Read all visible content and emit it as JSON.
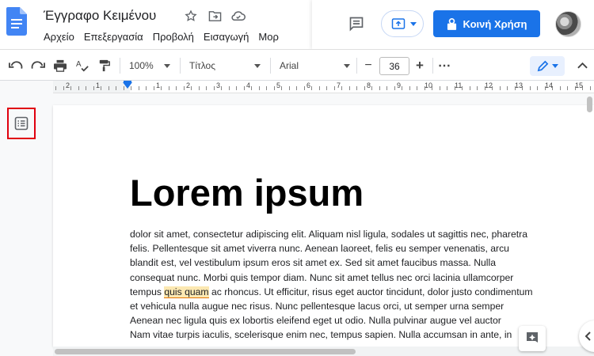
{
  "document": {
    "title": "Έγγραφο Κειμένου"
  },
  "menu": {
    "items": [
      "Αρχείο",
      "Επεξεργασία",
      "Προβολή",
      "Εισαγωγή",
      "Μορ"
    ]
  },
  "header": {
    "share_label": "Κοινή Χρήση",
    "accent_color": "#1a73e8"
  },
  "toolbar": {
    "zoom": "100%",
    "style": "Τίτλος",
    "font": "Arial",
    "font_size": "36",
    "decrease": "−",
    "increase": "+",
    "more": "⋯"
  },
  "ruler": {
    "numbers": [
      "2",
      "1",
      "1",
      "2",
      "3",
      "4",
      "5",
      "6",
      "7",
      "8",
      "9",
      "10",
      "11",
      "12",
      "13",
      "14",
      "15"
    ]
  },
  "content": {
    "heading": "Lorem ipsum",
    "lines": [
      "dolor sit amet, consectetur adipiscing elit. Aliquam nisl ligula, sodales ut sagittis  nec, pharetra",
      "felis. Pellentesque sit amet viverra nunc. Aenean laoreet, felis eu semper  venenatis, arcu",
      "blandit est, vel vestibulum ipsum eros sit amet ex. Sed sit amet faucibus  massa. Nulla",
      "consequat nunc. Morbi quis tempor diam. Nunc sit amet tellus nec orci lacinia  ullamcorper",
      "et vehicula nulla augue nec risus. Nunc pellentesque lacus orci, ut  semper urna semper",
      "Aenean nec ligula quis ex lobortis eleifend eget ut odio. Nulla pulvinar  augue vel auctor",
      "Nam vitae turpis iaculis, scelerisque enim nec, tempus sapien. Nulla  accumsan in ante, in"
    ],
    "highlight_line": {
      "before": "tempus ",
      "highlight": "quis quam",
      "after": " ac rhoncus. Ut efficitur, risus eget auctor tincidunt, dolor  justo condimentum"
    }
  }
}
